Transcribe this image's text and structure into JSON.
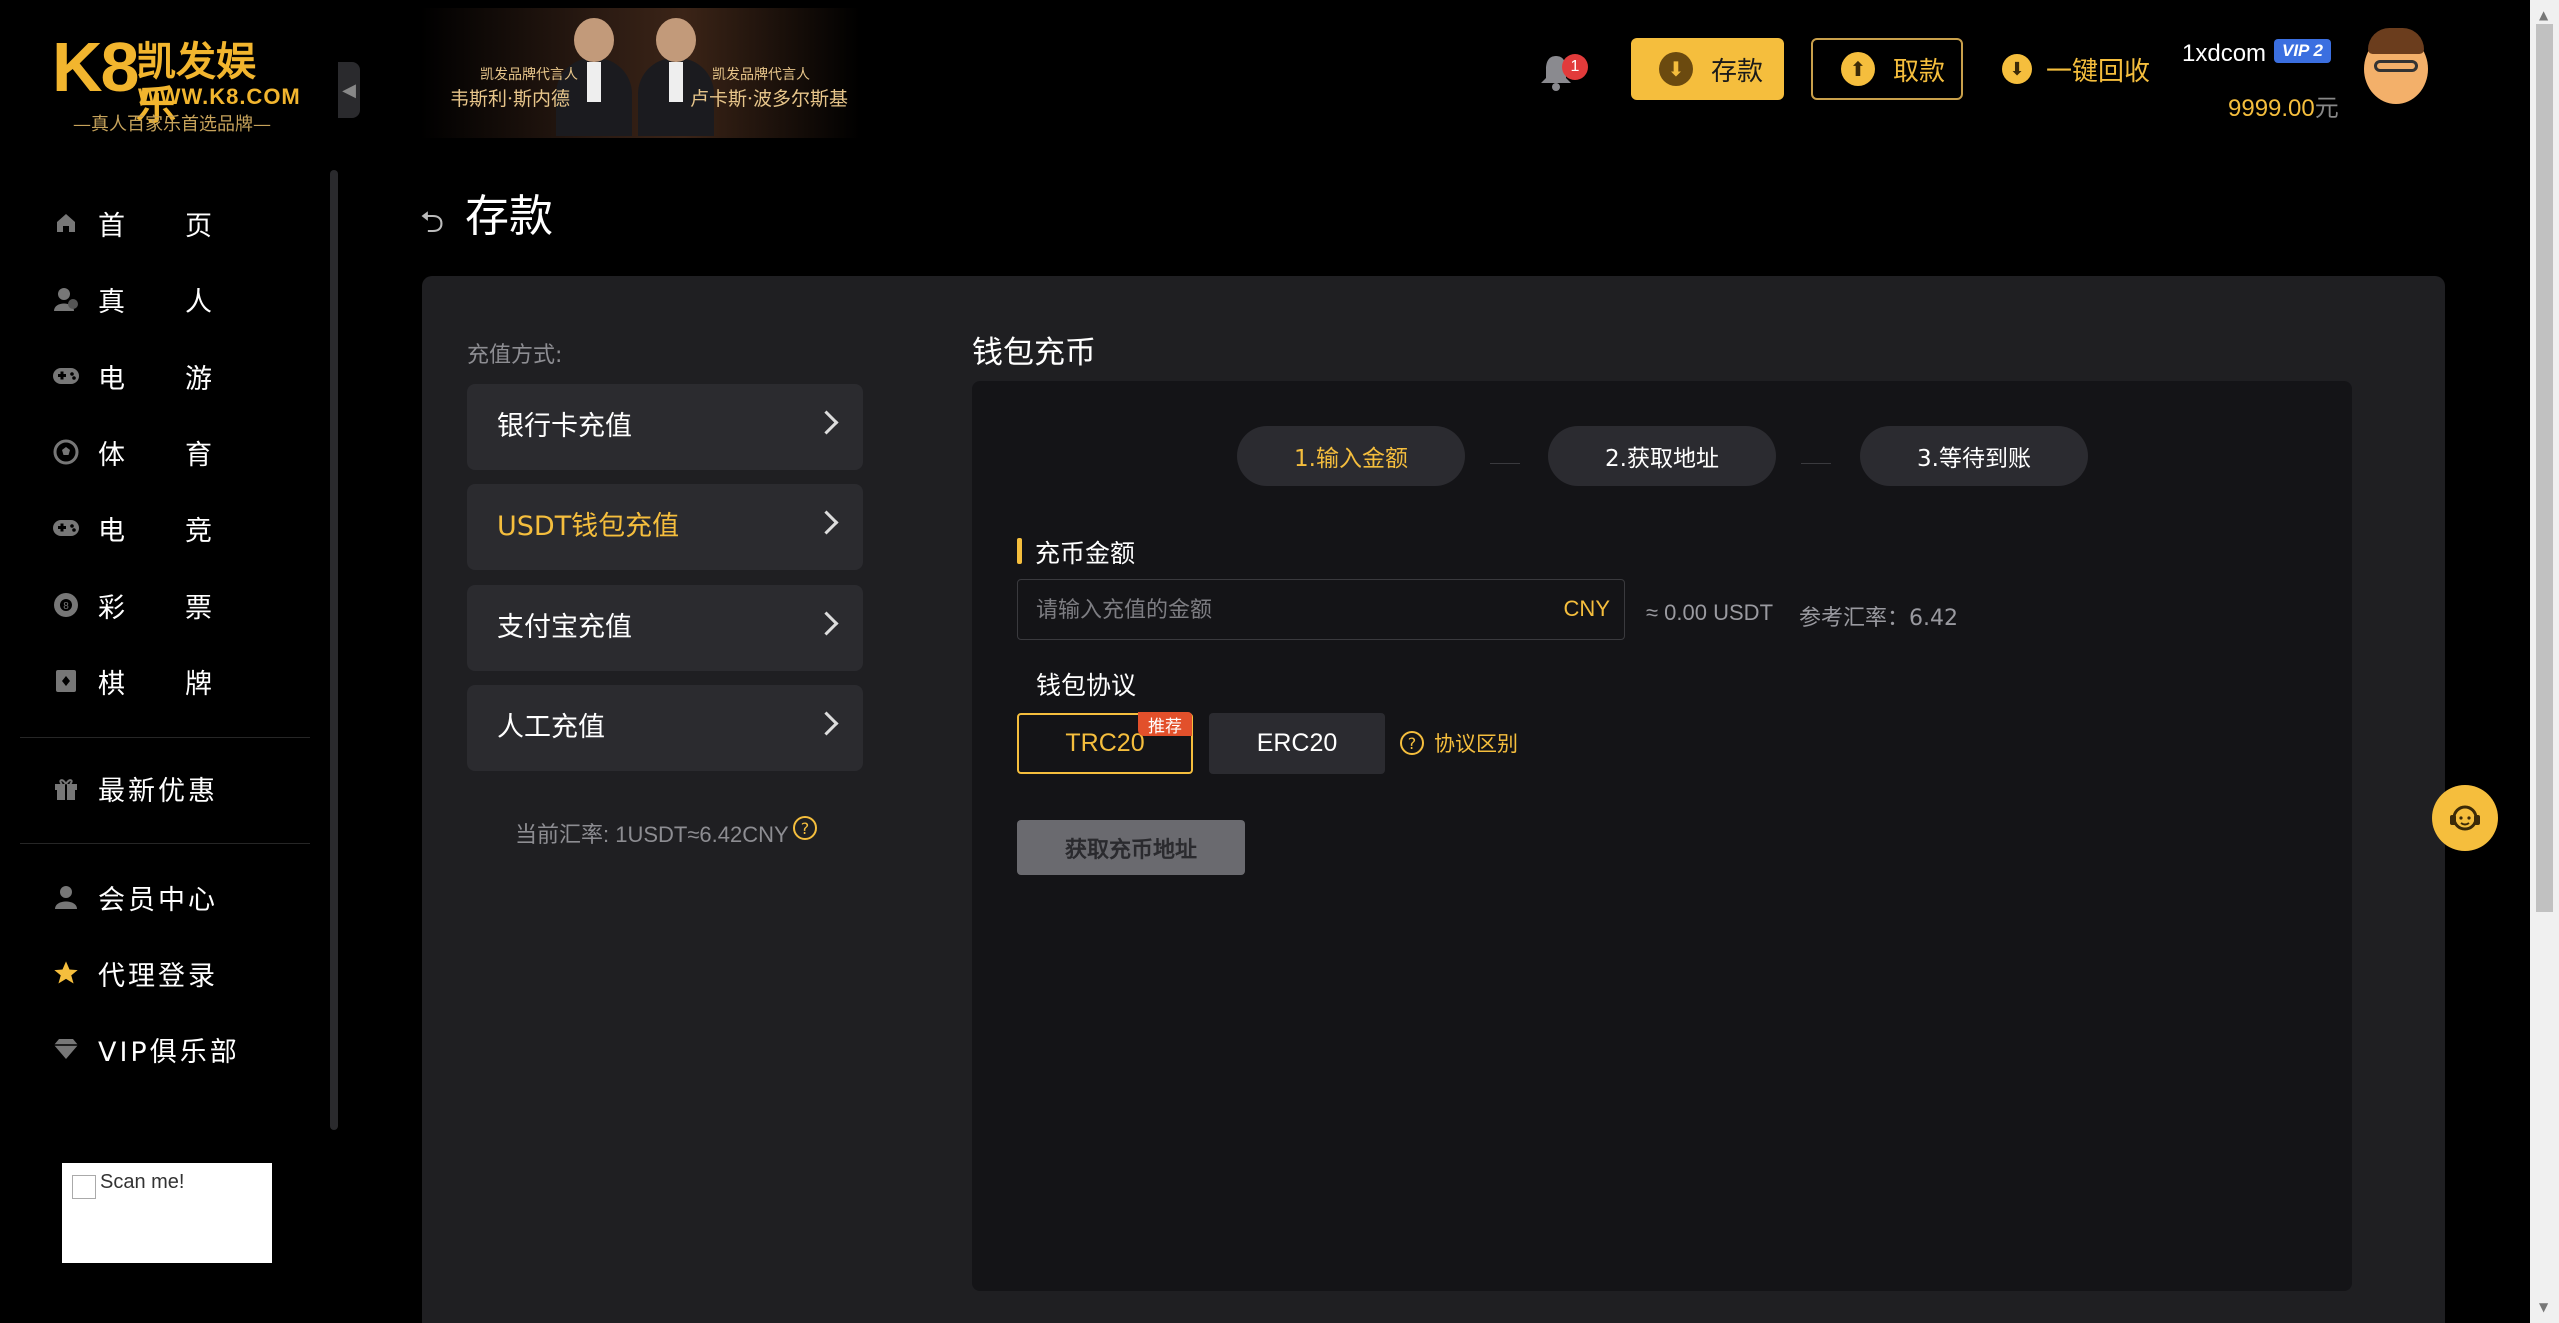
{
  "logo": {
    "brand": "K8",
    "name": "凯发娱乐",
    "url": "WWW.K8.COM",
    "slogan": "—真人百家乐首选品牌—"
  },
  "banner": {
    "ambassador1_title": "凯发品牌代言人",
    "ambassador1_name": "韦斯利·斯内德",
    "ambassador2_title": "凯发品牌代言人",
    "ambassador2_name": "卢卡斯·波多尔斯基"
  },
  "sidebar": {
    "items": [
      {
        "label": "首页",
        "icon": "home-icon"
      },
      {
        "label": "真人",
        "icon": "live-dealer-icon"
      },
      {
        "label": "电游",
        "icon": "gamepad-icon"
      },
      {
        "label": "体育",
        "icon": "soccer-ball-icon"
      },
      {
        "label": "电竞",
        "icon": "esports-gamepad-icon"
      },
      {
        "label": "彩票",
        "icon": "lottery-icon"
      },
      {
        "label": "棋牌",
        "icon": "cards-icon"
      }
    ],
    "promo": {
      "label": "最新优惠",
      "icon": "gift-icon"
    },
    "member": [
      {
        "label": "会员中心",
        "icon": "user-icon"
      },
      {
        "label": "代理登录",
        "icon": "star-icon"
      },
      {
        "label": "VIP俱乐部",
        "icon": "diamond-icon"
      }
    ],
    "qr_alt": "Scan me!"
  },
  "header": {
    "notification_count": "1",
    "deposit_label": "存款",
    "withdraw_label": "取款",
    "recycle_label": "一键回收",
    "username": "1xdcom",
    "vip_level": "VIP 2",
    "balance": "9999.00",
    "balance_unit": "元"
  },
  "page": {
    "title": "存款"
  },
  "methods": {
    "label": "充值方式:",
    "items": [
      "银行卡充值",
      "USDT钱包充值",
      "支付宝充值",
      "人工充值"
    ],
    "active_index": 1,
    "rate_text": "当前汇率: 1USDT≈6.42CNY"
  },
  "wallet": {
    "title": "钱包充币",
    "steps": [
      "1.输入金额",
      "2.获取地址",
      "3.等待到账"
    ],
    "amount_title": "充币金额",
    "amount_placeholder": "请输入充值的金额",
    "currency": "CNY",
    "usdt_estimate": "≈ 0.00 USDT",
    "ref_rate": "参考汇率：6.42",
    "protocol_title": "钱包协议",
    "protocols": [
      "TRC20",
      "ERC20"
    ],
    "recommend_tag": "推荐",
    "protocol_help": "协议区别",
    "get_address_label": "获取充币地址"
  },
  "colors": {
    "accent": "#f5be3d",
    "panel": "#1f1f22",
    "inner_panel": "#141417",
    "tag": "#e2502b"
  }
}
